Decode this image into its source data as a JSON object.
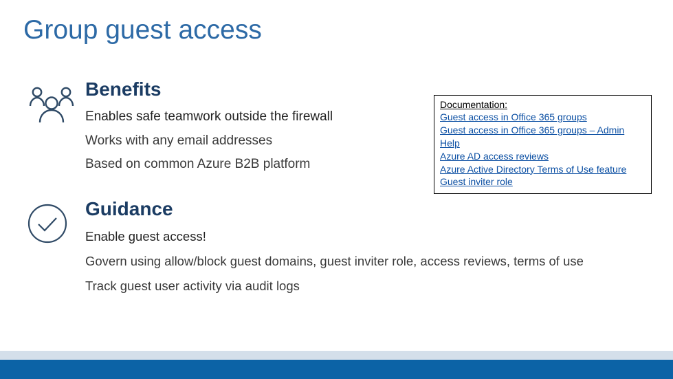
{
  "title": "Group guest access",
  "sections": {
    "benefits": {
      "heading": "Benefits",
      "items": [
        "Enables safe teamwork outside the firewall",
        "Works with any email addresses",
        "Based on common Azure B2B platform"
      ]
    },
    "guidance": {
      "heading": "Guidance",
      "items": [
        "Enable guest access!",
        "Govern using allow/block guest domains, guest inviter role, access reviews, terms of use",
        "Track guest user activity via audit logs"
      ]
    }
  },
  "documentation": {
    "heading": "Documentation:",
    "links": [
      "Guest access in Office 365 groups",
      "Guest access in Office 365 groups – Admin Help",
      "Azure AD access reviews",
      "Azure Active Directory Terms of Use feature",
      "Guest inviter role"
    ]
  },
  "colors": {
    "title": "#2d6aa6",
    "section": "#1b3c63",
    "link": "#0b4fa3",
    "footer": "#0c63a6",
    "footerTop": "#d4dfea",
    "iconStroke": "#2f4a66"
  }
}
